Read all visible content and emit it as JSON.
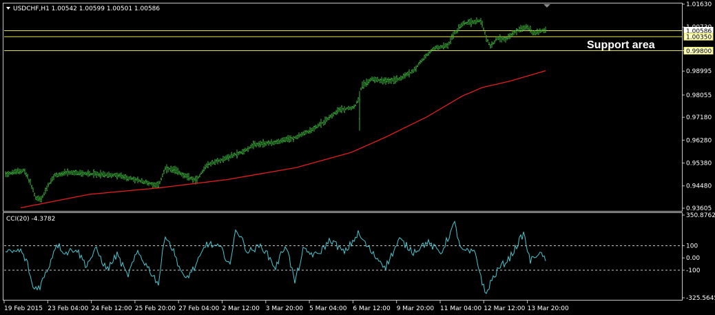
{
  "colors": {
    "background": "#000000",
    "frame": "#c8c8c8",
    "text": "#ffffff",
    "bars": "#3cb43c",
    "ma": "#e61e1e",
    "levels": "#e6e64a",
    "cci": "#48c8d2",
    "cci_level": "#c8c8c8",
    "tag_bg": "#ffffc8"
  },
  "icons": {
    "dropdown": "triangle-down-icon",
    "shift_marker": "triangle-down-icon"
  },
  "main_panel": {
    "title": "USDCHF,H1  1.00542 1.00599 1.00501 1.00586",
    "annotation": "Support area"
  },
  "cci_panel": {
    "title": "CCI(20) -4.3782"
  },
  "chart_data": [
    {
      "type": "bar",
      "panel": "price",
      "series": [
        {
          "name": "",
          "kind": "ohlc-bars",
          "y_start": 0.9495,
          "y_end": 1.0057
        },
        {
          "name": "",
          "kind": "moving-average",
          "y_start": 0.936,
          "y_end": 0.9901
        }
      ],
      "yticks": [
        "1.01630",
        "1.00730",
        "0.99800",
        "0.98995",
        "0.98055",
        "0.97180",
        "0.96280",
        "0.95380",
        "0.94480",
        "0.93605"
      ],
      "ylim": [
        0.93605,
        1.0163
      ],
      "levels": [
        {
          "value": 1.00586,
          "label": "1.00586"
        },
        {
          "value": 1.0035,
          "label": "1.00350"
        },
        {
          "value": 0.998,
          "label": "0.99800"
        }
      ],
      "grid": false
    },
    {
      "type": "line",
      "panel": "oscillator",
      "series": [
        {
          "name": "",
          "last": -4.3782
        }
      ],
      "yticks": [
        "350.8762",
        "100",
        "0.00",
        "-100",
        "-325.5645"
      ],
      "ylim": [
        -325.5645,
        350.8762
      ],
      "levels": [
        100,
        -100
      ],
      "grid": false
    }
  ],
  "xticks": [
    "19 Feb 2015",
    "23 Feb 04:00",
    "24 Feb 12:00",
    "25 Feb 20:00",
    "27 Feb 04:00",
    "2 Mar 12:00",
    "3 Mar 20:00",
    "5 Mar 04:00",
    "6 Mar 12:00",
    "9 Mar 20:00",
    "11 Mar 04:00",
    "12 Mar 12:00",
    "13 Mar 20:00"
  ]
}
